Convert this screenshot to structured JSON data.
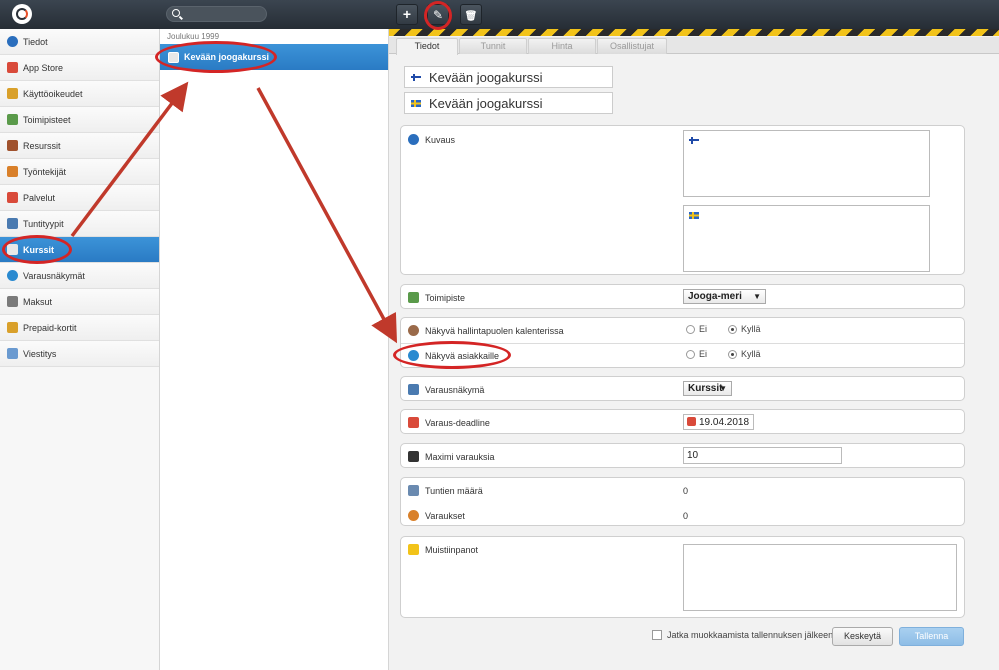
{
  "search": {
    "placeholder": ""
  },
  "toolbar": {
    "add_label": "+",
    "edit_label": "✎",
    "delete_label": "🗑"
  },
  "sidebar": {
    "items": [
      {
        "label": "Tiedot",
        "icon": "info-icon",
        "color": "#2a6ebd"
      },
      {
        "label": "App Store",
        "icon": "app-store-icon",
        "color": "#d94a3a"
      },
      {
        "label": "Käyttöoikeudet",
        "icon": "permissions-icon",
        "color": "#d9a02a"
      },
      {
        "label": "Toimipisteet",
        "icon": "location-icon",
        "color": "#5a9a4a"
      },
      {
        "label": "Resurssit",
        "icon": "resource-icon",
        "color": "#a0522d"
      },
      {
        "label": "Työntekijät",
        "icon": "employees-icon",
        "color": "#d9802a"
      },
      {
        "label": "Palvelut",
        "icon": "services-icon",
        "color": "#d94a3a"
      },
      {
        "label": "Tuntityypit",
        "icon": "lesson-type-icon",
        "color": "#4a7ab0"
      },
      {
        "label": "Kurssit",
        "icon": "courses-icon",
        "color": "#e8e8e8",
        "active": true
      },
      {
        "label": "Varausnäkymät",
        "icon": "booking-view-icon",
        "color": "#2a8ad0"
      },
      {
        "label": "Maksut",
        "icon": "payments-icon",
        "color": "#7a7a7a"
      },
      {
        "label": "Prepaid-kortit",
        "icon": "prepaid-card-icon",
        "color": "#d9a02a"
      },
      {
        "label": "Viestitys",
        "icon": "messaging-icon",
        "color": "#6a9ad0"
      }
    ]
  },
  "middle": {
    "group_header": "Joulukuu 1999",
    "selected_item": "Kevään joogakurssi"
  },
  "tabs": [
    {
      "label": "Tiedot",
      "active": true
    },
    {
      "label": "Tunnit"
    },
    {
      "label": "Hinta"
    },
    {
      "label": "Osallistujat"
    }
  ],
  "form": {
    "title_fi": "Kevään joogakurssi",
    "title_sv": "Kevään joogakurssi",
    "description_label": "Kuvaus",
    "location_label": "Toimipiste",
    "location_value": "Jooga-meri",
    "visible_admin_label": "Näkyvä hallintapuolen kalenterissa",
    "visible_customers_label": "Näkyvä asiakkaille",
    "radio_no": "Ei",
    "radio_yes": "Kyllä",
    "booking_view_label": "Varausnäkymä",
    "booking_view_value": "Kurssit",
    "deadline_label": "Varaus-deadline",
    "deadline_value": "19.04.2018",
    "max_bookings_label": "Maximi varauksia",
    "max_bookings_value": "10",
    "lesson_count_label": "Tuntien määrä",
    "lesson_count_value": "0",
    "bookings_label": "Varaukset",
    "bookings_value": "0",
    "notes_label": "Muistiinpanot",
    "continue_label": "Jatka muokkaamista tallennuksen jälkeen",
    "cancel_label": "Keskeytä",
    "save_label": "Tallenna"
  },
  "colors": {
    "accent": "#2a7bc4",
    "annotation": "#d42525",
    "stripe_yellow": "#f2c319"
  }
}
